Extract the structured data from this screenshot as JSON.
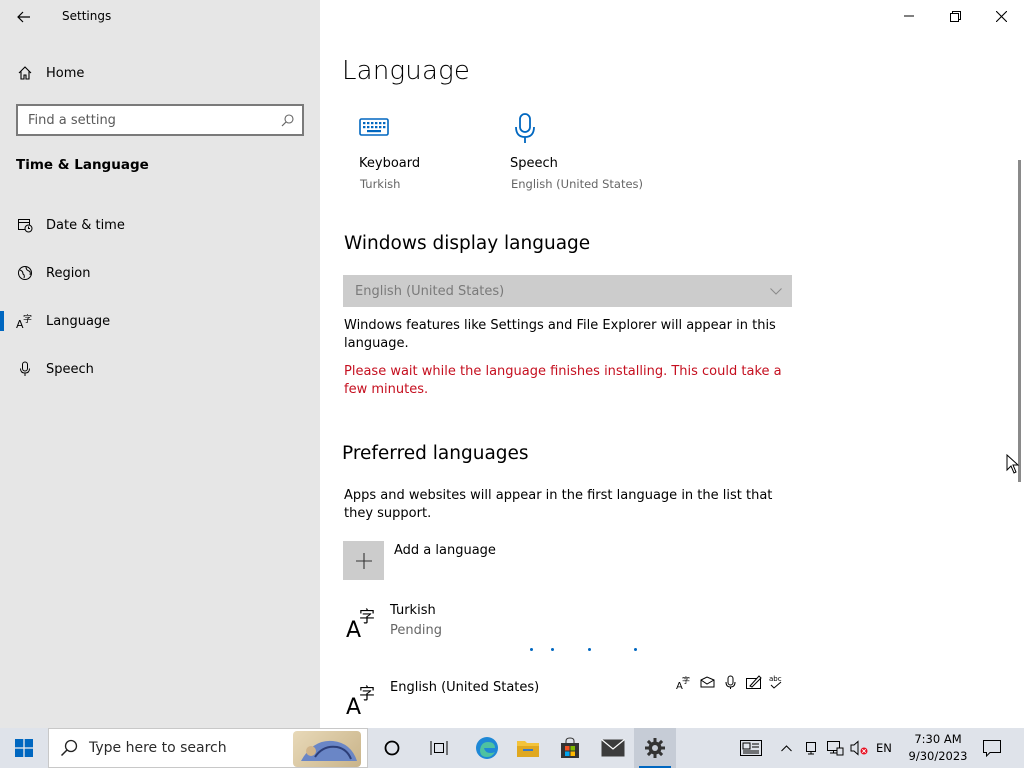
{
  "window": {
    "title": "Settings"
  },
  "sidebar": {
    "home_label": "Home",
    "search_placeholder": "Find a setting",
    "section_title": "Time & Language",
    "items": [
      {
        "label": "Date & time",
        "icon": "calendar-clock-icon"
      },
      {
        "label": "Region",
        "icon": "globe-icon"
      },
      {
        "label": "Language",
        "icon": "language-icon",
        "selected": true
      },
      {
        "label": "Speech",
        "icon": "microphone-icon"
      }
    ]
  },
  "main": {
    "title": "Language",
    "tiles": [
      {
        "name": "Keyboard",
        "sub": "Turkish",
        "icon": "keyboard-icon"
      },
      {
        "name": "Speech",
        "sub": "English (United States)",
        "icon": "microphone-icon"
      }
    ],
    "display_language": {
      "heading": "Windows display language",
      "selected": "English (United States)",
      "description": "Windows features like Settings and File Explorer will appear in this language.",
      "warning": "Please wait while the language finishes installing. This could take a few minutes."
    },
    "preferred": {
      "heading": "Preferred languages",
      "description": "Apps and websites will appear in the first language in the list that they support.",
      "add_label": "Add a language",
      "languages": [
        {
          "name": "Turkish",
          "status": "Pending"
        },
        {
          "name": "English (United States)",
          "status": ""
        }
      ]
    }
  },
  "taskbar": {
    "search_placeholder": "Type here to search",
    "language": "EN",
    "time": "7:30 AM",
    "date": "9/30/2023"
  },
  "colors": {
    "accent": "#0067c0",
    "warning": "#c50f1f",
    "sidebar_bg": "#e6e6e6",
    "taskbar_bg": "#dfe3ea"
  }
}
